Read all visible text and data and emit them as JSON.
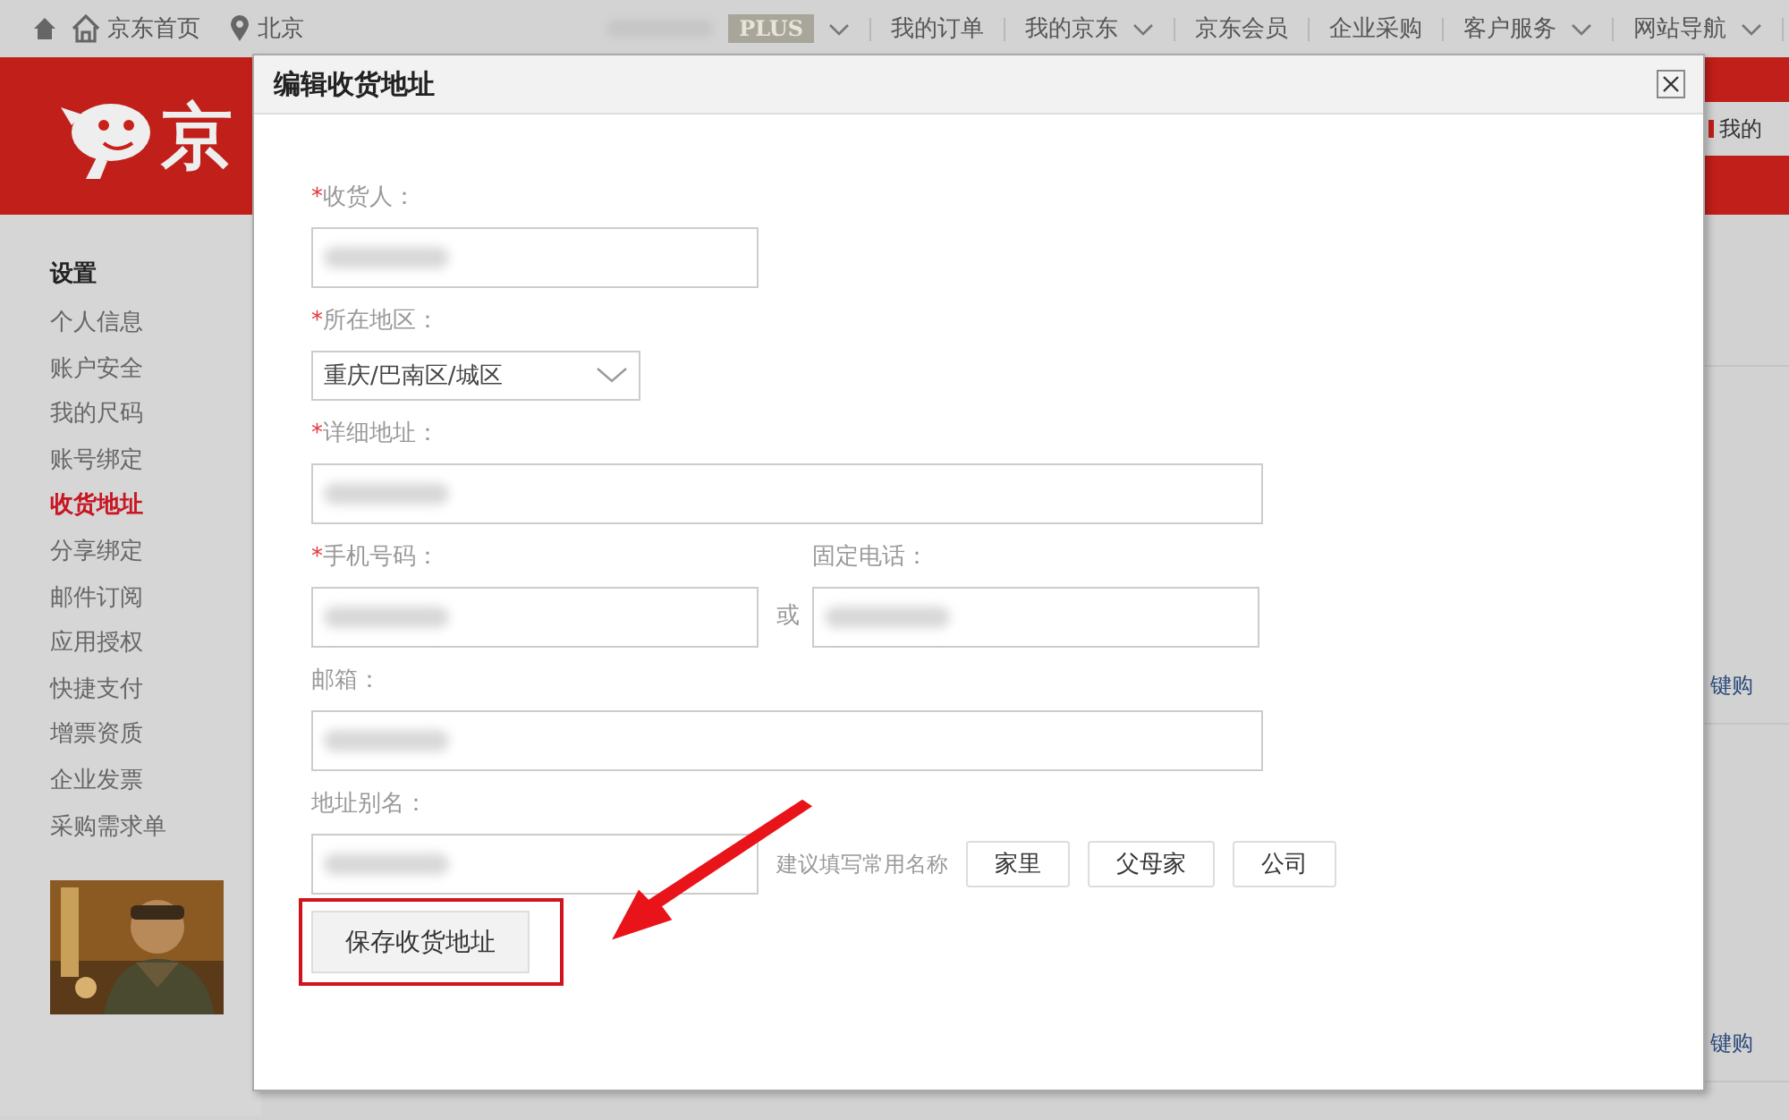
{
  "top_bar": {
    "home_link": "京东首页",
    "location": "北京",
    "member_badge": "PLUS",
    "member_dropdown": true,
    "nav": [
      {
        "label": "我的订单",
        "dropdown": false
      },
      {
        "label": "我的京东",
        "dropdown": true
      },
      {
        "label": "京东会员",
        "dropdown": false
      },
      {
        "label": "企业采购",
        "dropdown": false
      },
      {
        "label": "客户服务",
        "dropdown": true
      },
      {
        "label": "网站导航",
        "dropdown": true
      }
    ]
  },
  "header": {
    "logo_text": "京",
    "cart_link": "我的"
  },
  "sidebar": {
    "heading": "设置",
    "items": [
      {
        "label": "个人信息",
        "selected": false
      },
      {
        "label": "账户安全",
        "selected": false
      },
      {
        "label": "我的尺码",
        "selected": false
      },
      {
        "label": "账号绑定",
        "selected": false
      },
      {
        "label": "收货地址",
        "selected": true
      },
      {
        "label": "分享绑定",
        "selected": false
      },
      {
        "label": "邮件订阅",
        "selected": false
      },
      {
        "label": "应用授权",
        "selected": false
      },
      {
        "label": "快捷支付",
        "selected": false
      },
      {
        "label": "增票资质",
        "selected": false
      },
      {
        "label": "企业发票",
        "selected": false
      },
      {
        "label": "采购需求单",
        "selected": false
      }
    ]
  },
  "background_links": [
    "键购",
    "键购"
  ],
  "dialog": {
    "title": "编辑收货地址",
    "fields": [
      {
        "kind": "text",
        "required_mark": "*",
        "label": "收货人：",
        "blurred": true
      },
      {
        "kind": "select",
        "required_mark": "*",
        "label": "所在地区：",
        "value": "重庆/巴南区/城区"
      },
      {
        "kind": "wide_text",
        "required_mark": "*",
        "label": "详细地址：",
        "blurred": true
      },
      {
        "kind": "pair",
        "required_mark": "*",
        "label": "手机号码：",
        "blurred": true,
        "separator": "或",
        "second_label": "固定电话：",
        "second_blurred": true
      },
      {
        "kind": "wide_text",
        "label": "邮箱：",
        "blurred": true
      },
      {
        "kind": "alias",
        "label": "地址别名：",
        "blurred": true,
        "hint": "建议填写常用名称",
        "suggestions": [
          "家里",
          "父母家",
          "公司"
        ]
      }
    ],
    "save_button": {
      "label": "保存收货地址",
      "highlighted": true
    },
    "annotation_arrow": true
  }
}
